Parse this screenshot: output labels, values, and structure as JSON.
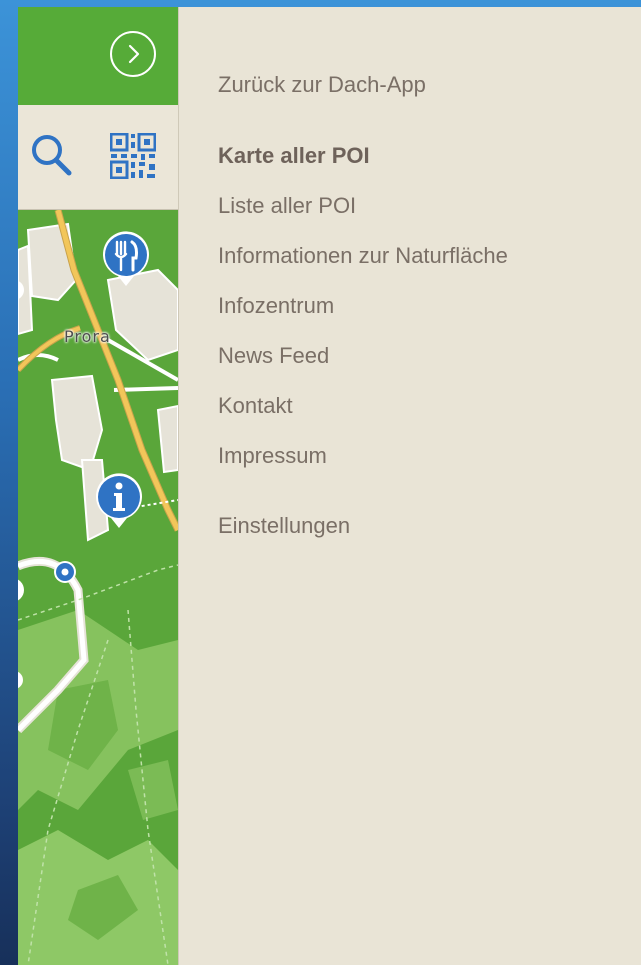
{
  "header": {
    "toggle_icon": "chevron-right-circle-icon"
  },
  "toolbar": {
    "search_icon": "search-icon",
    "qr_icon": "qr-code-icon"
  },
  "map": {
    "place_label": "Prora",
    "markers": [
      {
        "name": "restaurant-marker",
        "icon": "fork-knife-icon",
        "color": "#2f73c4"
      },
      {
        "name": "info-marker",
        "icon": "info-icon",
        "color": "#2f73c4"
      },
      {
        "name": "location-dot",
        "icon": "dot-icon",
        "color": "#2f73c4"
      }
    ],
    "colors": {
      "forest": "#5aa63a",
      "meadow": "#86c25e",
      "built": "#e6e3d8",
      "road": "#f2c65a"
    }
  },
  "menu": {
    "back": "Zurück zur Dach-App",
    "items": [
      {
        "label": "Karte aller POI",
        "active": true
      },
      {
        "label": "Liste aller POI"
      },
      {
        "label": "Informationen zur Naturfläche"
      },
      {
        "label": "Infozentrum"
      },
      {
        "label": "News Feed"
      },
      {
        "label": "Kontakt"
      },
      {
        "label": "Impressum"
      }
    ],
    "settings": "Einstellungen"
  },
  "colors": {
    "accent_green": "#56ab38",
    "panel_bg": "#e9e4d6",
    "menu_text": "#7a6f66",
    "marker_blue": "#2f73c4"
  }
}
